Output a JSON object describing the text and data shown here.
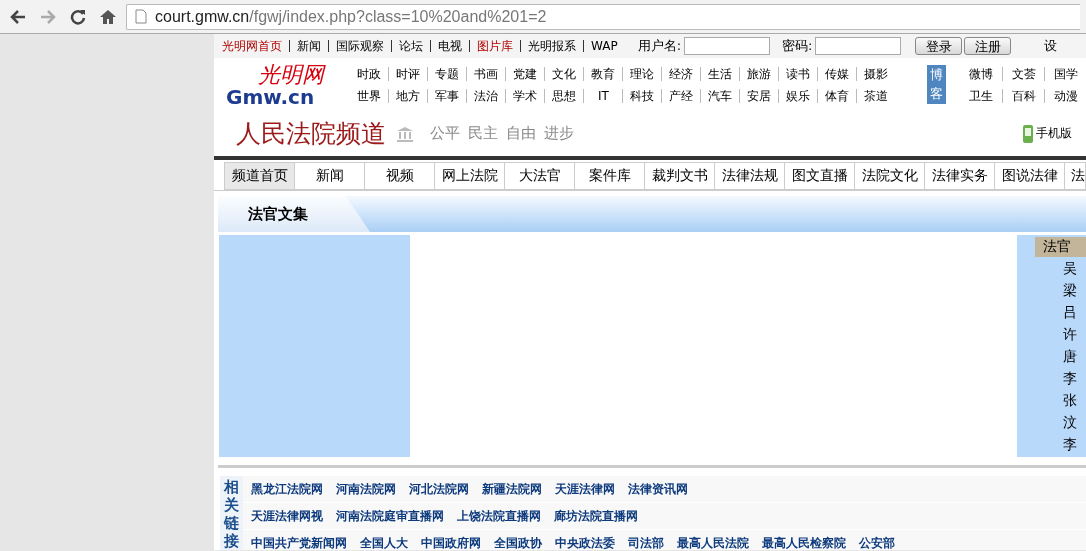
{
  "browser": {
    "url_host": "court.gmw.cn",
    "url_path": "/fgwj/index.php?class=10%20and%201=2"
  },
  "top_links": [
    {
      "label": "光明网首页",
      "highlighted": true
    },
    {
      "label": "新闻",
      "highlighted": false
    },
    {
      "label": "国际观察",
      "highlighted": false
    },
    {
      "label": "论坛",
      "highlighted": false
    },
    {
      "label": "电视",
      "highlighted": false
    },
    {
      "label": "图片库",
      "highlighted": true
    },
    {
      "label": "光明报系",
      "highlighted": false
    },
    {
      "label": "WAP",
      "highlighted": false
    }
  ],
  "login": {
    "username_label": "用户名:",
    "password_label": "密码:",
    "buttons": [
      "登录",
      "注册"
    ],
    "cut_link": "设"
  },
  "logo": {
    "script": "光明网",
    "domain": "Gmw.cn"
  },
  "channel_rows": [
    [
      "时政",
      "时评",
      "专题",
      "书画",
      "党建",
      "文化",
      "教育",
      "理论",
      "经济",
      "生活",
      "旅游",
      "读书",
      "传媒",
      "摄影"
    ],
    [
      "世界",
      "地方",
      "军事",
      "法治",
      "学术",
      "思想",
      "IT",
      "科技",
      "产经",
      "汽车",
      "安居",
      "娱乐",
      "体育",
      "茶道"
    ]
  ],
  "blog_badge": "博客",
  "extra_rows": [
    [
      "微博",
      "文荟",
      "国学"
    ],
    [
      "卫生",
      "百科",
      "动漫"
    ]
  ],
  "header": {
    "title": "人民法院频道",
    "slogans": [
      "公平",
      "民主",
      "自由",
      "进步"
    ],
    "mobile": "手机版"
  },
  "nav_tabs": [
    {
      "label": "频道首页",
      "selected": true
    },
    {
      "label": "新闻",
      "selected": false
    },
    {
      "label": "视频",
      "selected": false
    },
    {
      "label": "网上法院",
      "selected": false
    },
    {
      "label": "大法官",
      "selected": false
    },
    {
      "label": "案件库",
      "selected": false
    },
    {
      "label": "裁判文书",
      "selected": false
    },
    {
      "label": "法律法规",
      "selected": false
    },
    {
      "label": "图文直播",
      "selected": false
    },
    {
      "label": "法院文化",
      "selected": false
    },
    {
      "label": "法律实务",
      "selected": false
    },
    {
      "label": "图说法律",
      "selected": false
    },
    {
      "label": "法",
      "selected": false
    }
  ],
  "section_title": "法官文集",
  "sidebar": {
    "heading": "法官",
    "items": [
      "吴",
      "梁",
      "吕",
      "许",
      "唐",
      "李",
      "张",
      "汶",
      "李"
    ]
  },
  "related": {
    "label": "相关链接",
    "lines": [
      {
        "links": [
          "黑龙江法院网",
          "河南法院网",
          "河北法院网",
          "新疆法院网",
          "天涯法律网",
          "法律资讯网"
        ]
      },
      {
        "links": [
          "天涯法律网视",
          "河南法院庭审直播网",
          "上饶法院直播网",
          "廊坊法院直播网"
        ]
      },
      {
        "links": [
          "中国共产党新闻网",
          "全国人大",
          "中国政府网",
          "全国政协",
          "中央政法委",
          "司法部",
          "最高人民法院",
          "最高人民检察院",
          "公安部"
        ]
      }
    ]
  }
}
